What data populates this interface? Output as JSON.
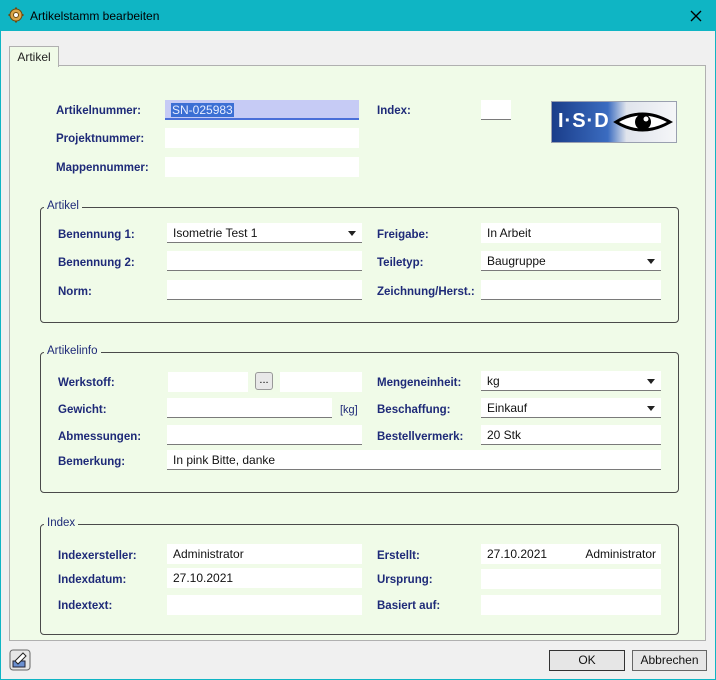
{
  "window": {
    "title": "Artikelstamm bearbeiten"
  },
  "tabs": [
    {
      "label": "Artikel"
    }
  ],
  "header": {
    "artikelnummer_label": "Artikelnummer:",
    "artikelnummer_value": "SN-025983",
    "projektnummer_label": "Projektnummer:",
    "projektnummer_value": "",
    "mappennummer_label": "Mappennummer:",
    "mappennummer_value": "",
    "index_label": "Index:",
    "index_value": ""
  },
  "artikel": {
    "title": "Artikel",
    "benennung1_label": "Benennung 1:",
    "benennung1_value": "Isometrie Test 1",
    "benennung2_label": "Benennung 2:",
    "benennung2_value": "",
    "norm_label": "Norm:",
    "norm_value": "",
    "freigabe_label": "Freigabe:",
    "freigabe_value": "In Arbeit",
    "teiletyp_label": "Teiletyp:",
    "teiletyp_value": "Baugruppe",
    "zeichnung_label": "Zeichnung/Herst.:",
    "zeichnung_value": ""
  },
  "artikelinfo": {
    "title": "Artikelinfo",
    "werkstoff_label": "Werkstoff:",
    "werkstoff_value": "",
    "werkstoff_value2": "",
    "browse_label": "...",
    "gewicht_label": "Gewicht:",
    "gewicht_value": "",
    "gewicht_unit": "[kg]",
    "abmessungen_label": "Abmessungen:",
    "abmessungen_value": "",
    "bemerkung_label": "Bemerkung:",
    "bemerkung_value": "In pink Bitte, danke",
    "mengeneinheit_label": "Mengeneinheit:",
    "mengeneinheit_value": "kg",
    "beschaffung_label": "Beschaffung:",
    "beschaffung_value": "Einkauf",
    "bestellvermerk_label": "Bestellvermerk:",
    "bestellvermerk_value": "20 Stk"
  },
  "index": {
    "title": "Index",
    "ersteller_label": "Indexersteller:",
    "ersteller_value": "Administrator",
    "datum_label": "Indexdatum:",
    "datum_value": "27.10.2021",
    "text_label": "Indextext:",
    "text_value": "",
    "erstellt_label": "Erstellt:",
    "erstellt_date": "27.10.2021",
    "erstellt_user": "Administrator",
    "ursprung_label": "Ursprung:",
    "ursprung_value": "",
    "basiert_label": "Basiert auf:",
    "basiert_value": ""
  },
  "logo": {
    "text": "I·S·D"
  },
  "buttons": {
    "ok": "OK",
    "cancel": "Abbrechen"
  },
  "icons": {
    "app": "gear-icon",
    "close": "close-icon",
    "edit": "edit-icon",
    "logo_eye": "eye-icon"
  },
  "colors": {
    "titlebar": "#0fb5c4",
    "panel": "#f0fbe8",
    "label": "#1e2a78"
  }
}
